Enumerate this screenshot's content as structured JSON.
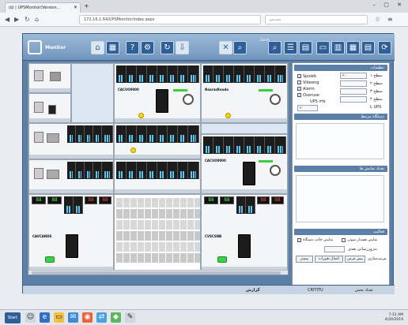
{
  "browser": {
    "tab_title": "(۵) | UPSMonitor(Version...",
    "url": "172.16.1.64/UPSMonitor/index.aspx",
    "search_placeholder": "جستجو"
  },
  "app": {
    "logo_text": "Monitor",
    "zoom_label": "Zoom"
  },
  "devices": {
    "upper_left": "CACUO0000",
    "upper_right": "NaarasRoudo",
    "middle": "CACUO0000",
    "lower_left": "CAVCANDS",
    "lower_right": "CVSCSNB"
  },
  "panel": {
    "section_options": "تنظیمات",
    "row1": "سطح ۱",
    "row2": "سطح ۲",
    "row3": "سطح ۳",
    "row4": "سطح ۴",
    "check_items": [
      "Spoleb",
      "Vibeeng",
      "Alarm",
      "Overuse",
      "UPS ۷۳۵"
    ],
    "select_val": "۲۰",
    "row5": "تا UPS",
    "section_gallery": "دستگاه مرتبط",
    "section_sessions": "تعداد نمایش ها",
    "section_view": "فعالیت",
    "check_auto": "نمایش هشدار صوتی",
    "check_refresh": "نمایش حالت دستگاه",
    "period_label": "به‌روزرسانی بعدی",
    "sort_label": "مرتب‌سازی",
    "btn_prev": "بیشتر",
    "btn_apply": "اعمال تغییرات",
    "btn_reset": "پیش فرض",
    "status_label": "تعداد بخش",
    "status_value": "CRITITU",
    "status_left": "گزارش",
    "date_label": "تاریخ"
  },
  "taskbar": {
    "start_label": "Start",
    "time": "7:31 AM",
    "date": "4/20/2019"
  }
}
